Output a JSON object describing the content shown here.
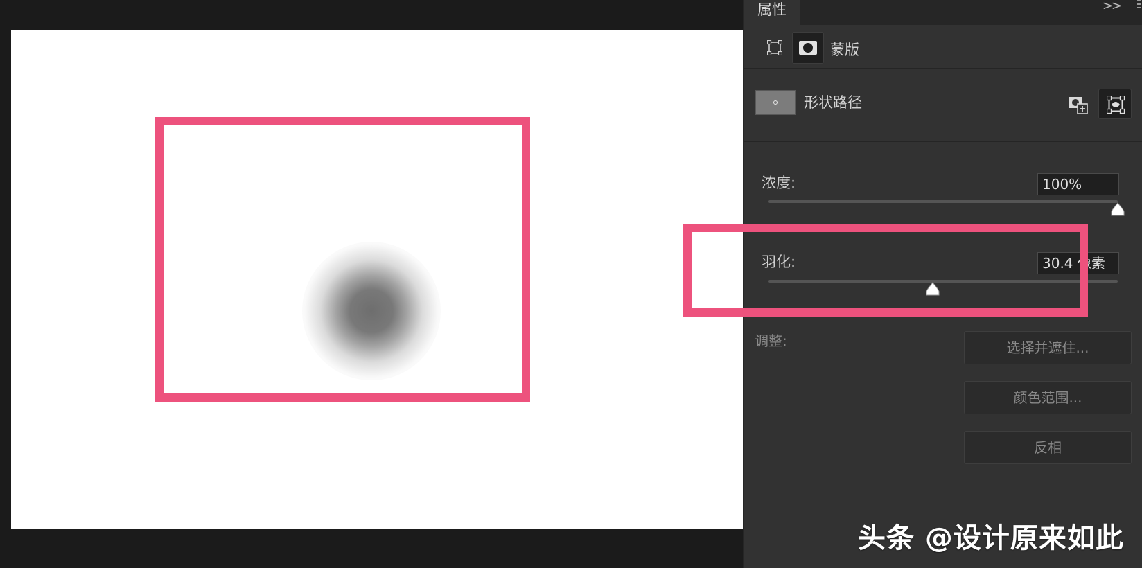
{
  "panel": {
    "tab_title": "属性",
    "collapse_glyph": ">>",
    "mask_label": "蒙版",
    "shape_path_label": "形状路径",
    "density": {
      "label": "浓度:",
      "value": "100%",
      "level_percent": 100
    },
    "feather": {
      "label": "羽化:",
      "value": "30.4 像素",
      "level_percent": 47
    },
    "adjust": {
      "label": "调整:",
      "buttons": [
        "选择并遮住...",
        "颜色范围...",
        "反相"
      ]
    }
  },
  "colors": {
    "highlight": "#ed527d",
    "panel_bg": "#323232",
    "canvas_bg": "#ffffff"
  },
  "watermark": "头条 @设计原来如此"
}
